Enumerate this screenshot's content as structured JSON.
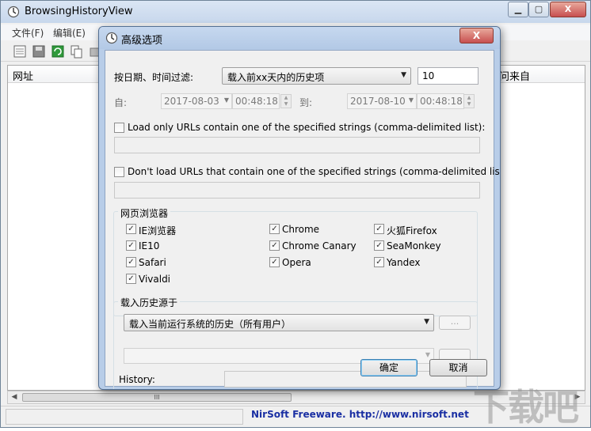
{
  "main_window": {
    "title": "BrowsingHistoryView",
    "menu": [
      "文件(F)",
      "编辑(E)"
    ],
    "columns": {
      "url": "网址",
      "referrer_partial": "问来自"
    },
    "scroll_thumb_grip": "III",
    "status_link": "NirSoft Freeware.  http://www.nirsoft.net",
    "watermark": "下载吧"
  },
  "dialog": {
    "title": "高级选项",
    "filter": {
      "label": "按日期、时间过滤:",
      "selected": "载入前xx天内的历史项",
      "days_value": "10"
    },
    "date_range": {
      "from_label": "自:",
      "from_date": "2017-08-03",
      "from_time": "00:48:18",
      "to_label": "到:",
      "to_date": "2017-08-10",
      "to_time": "00:48:18"
    },
    "load_only": {
      "label": "Load only URLs contain one of the specified strings (comma-delimited list):",
      "checked": false,
      "value": ""
    },
    "dont_load": {
      "label": "Don't load URLs that contain one of the specified strings (comma-delimited list):",
      "checked": false,
      "value": ""
    },
    "browsers": {
      "group_title": "网页浏览器",
      "items": [
        {
          "label": "IE浏览器",
          "checked": true
        },
        {
          "label": "Chrome",
          "checked": true
        },
        {
          "label": "火狐Firefox",
          "checked": true
        },
        {
          "label": "IE10",
          "checked": true
        },
        {
          "label": "Chrome Canary",
          "checked": true
        },
        {
          "label": "SeaMonkey",
          "checked": true
        },
        {
          "label": "Safari",
          "checked": true
        },
        {
          "label": "Opera",
          "checked": true
        },
        {
          "label": "Yandex",
          "checked": true
        },
        {
          "label": "Vivaldi",
          "checked": true
        }
      ]
    },
    "source": {
      "group_title": "载入历史源于",
      "selected": "载入当前运行系统的历史（所有用户）",
      "browse_label": "...",
      "history_label": "History:"
    },
    "ok_label": "确定",
    "cancel_label": "取消",
    "close_glyph": "X",
    "check_glyph": "✓"
  }
}
